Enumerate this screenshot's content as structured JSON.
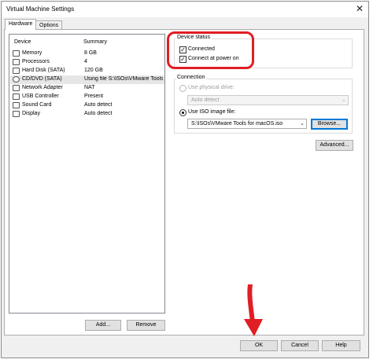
{
  "window": {
    "title": "Virtual Machine Settings",
    "close_glyph": "✕"
  },
  "tabs": [
    {
      "label": "Hardware",
      "selected": true
    },
    {
      "label": "Options",
      "selected": false
    }
  ],
  "device_list": {
    "header_device": "Device",
    "header_summary": "Summary",
    "rows": [
      {
        "icon": "memory-icon",
        "name": "Memory",
        "summary": "8 GB"
      },
      {
        "icon": "processor-icon",
        "name": "Processors",
        "summary": "4"
      },
      {
        "icon": "hard-disk-icon",
        "name": "Hard Disk (SATA)",
        "summary": "120 GB"
      },
      {
        "icon": "cd-dvd-icon",
        "name": "CD/DVD (SATA)",
        "summary": "Using file S:\\ISOs\\VMware Tools for macOS.iso",
        "selected": true
      },
      {
        "icon": "network-adapter-icon",
        "name": "Network Adapter",
        "summary": "NAT"
      },
      {
        "icon": "usb-controller-icon",
        "name": "USB Controller",
        "summary": "Present"
      },
      {
        "icon": "sound-card-icon",
        "name": "Sound Card",
        "summary": "Auto detect"
      },
      {
        "icon": "display-icon",
        "name": "Display",
        "summary": "Auto detect"
      }
    ]
  },
  "device_buttons": {
    "add": "Add...",
    "remove": "Remove"
  },
  "device_status": {
    "title": "Device status",
    "connected_label": "Connected",
    "connected_checked": true,
    "power_on_label": "Connect at power on",
    "power_on_checked": true,
    "check_glyph": "✓"
  },
  "connection": {
    "title": "Connection",
    "physical_label": "Use physical drive:",
    "physical_value": "Auto detect",
    "physical_enabled": false,
    "iso_label": "Use ISO image file:",
    "iso_value": "S:\\ISOs\\VMware Tools for macOS.iso",
    "iso_selected": true,
    "browse": "Browse...",
    "dropdown_glyph": "⌄"
  },
  "advanced_button": "Advanced...",
  "footer": {
    "ok": "OK",
    "cancel": "Cancel",
    "help": "Help"
  },
  "annotation_color": "#e01e24"
}
